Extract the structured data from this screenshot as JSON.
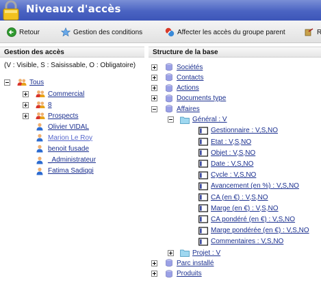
{
  "window": {
    "title": "Niveaux d'accès"
  },
  "toolbar": {
    "retour": "Retour",
    "conditions": "Gestion des conditions",
    "affecter": "Affecter les accès du groupe parent",
    "cut": "Re"
  },
  "left": {
    "header": "Gestion des accès",
    "legend": "(V : Visible, S : Saisissable, O : Obligatoire)",
    "root": "Tous",
    "groups": [
      "Commercial",
      "8",
      "Prospects"
    ],
    "users": [
      "Olivier VIDAL",
      "Marion Le Roy",
      "benoit fusade",
      "_Administrateur",
      "Fatima Sadiqgi"
    ]
  },
  "right": {
    "header": "Structure de la base",
    "tables": [
      "Sociétés",
      "Contacts",
      "Actions",
      "Documents type",
      "Affaires"
    ],
    "general": "Général : V",
    "fields": [
      "Gestionnaire : V,S,NO",
      "Etat : V,S,NO",
      "Objet : V,S,NO",
      "Date : V,S,NO",
      "Cycle : V,S,NO",
      "Avancement (en %) : V,S,NO",
      "CA (en €) : V,S,NO",
      "Marge (en €) : V,S,NO",
      "CA pondéré (en €) : V,S,NO",
      "Marge pondérée (en €) : V,S,NO",
      "Commentaires : V,S,NO"
    ],
    "projet": "Projet : V",
    "tables_after": [
      "Parc installé",
      "Produits"
    ]
  },
  "colors": {
    "title_bar": "#4a63c2",
    "link": "#1a2f8f"
  }
}
